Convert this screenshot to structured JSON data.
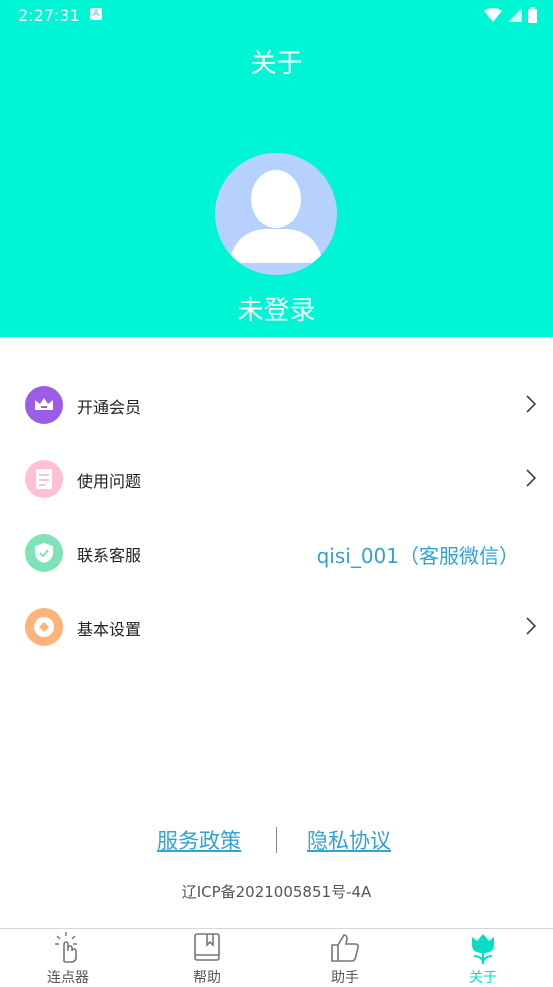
{
  "status_bar": {
    "time": "2:27:31",
    "sim_badge": "A"
  },
  "header": {
    "title": "关于",
    "login_status": "未登录",
    "bg_color": "#00f5d4"
  },
  "menu": [
    {
      "label": "开通会员",
      "icon": "crown-icon",
      "color": "#9b5de5"
    },
    {
      "label": "使用问题",
      "icon": "document-icon",
      "color": "#ffc0d6"
    },
    {
      "label": "联系客服",
      "icon": "shield-check-icon",
      "color": "#7ee4b8"
    },
    {
      "label": "基本设置",
      "icon": "settings-icon",
      "color": "#ffb37a"
    }
  ],
  "customer_service_contact": "qisi_001（客服微信）",
  "footer": {
    "service_policy": "服务政策",
    "privacy_agreement": "隐私协议",
    "icp": "辽ICP备2021005851号-4A"
  },
  "bottom_nav": [
    {
      "label": "连点器",
      "icon": "tap-hand-icon",
      "active": false
    },
    {
      "label": "帮助",
      "icon": "book-icon",
      "active": false
    },
    {
      "label": "助手",
      "icon": "thumbs-up-icon",
      "active": false
    },
    {
      "label": "关于",
      "icon": "tulip-icon",
      "active": true
    }
  ],
  "accent_color": "#00e0c6",
  "link_color": "#2fa3d6"
}
